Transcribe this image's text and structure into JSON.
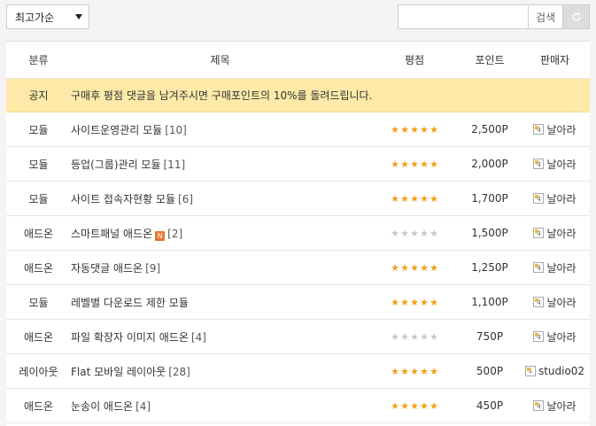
{
  "toolbar": {
    "sort_selected": "최고가순",
    "search_placeholder": "",
    "search_value": "",
    "search_button": "검색",
    "reset_icon": "refresh-icon"
  },
  "columns": {
    "category": "분류",
    "title": "제목",
    "rating": "평점",
    "point": "포인트",
    "seller": "판매자"
  },
  "notice": {
    "category": "공지",
    "text": "구매후 평점 댓글을 남겨주시면 구매포인트의 10%를 돌려드립니다."
  },
  "colors": {
    "star_on": "#f1a01a",
    "star_off": "#c8c8c8",
    "notice_bg": "#fdeaa8"
  },
  "items": [
    {
      "category": "모듈",
      "title": "사이트운영관리 모듈",
      "count": "[10]",
      "new": "",
      "stars": 5,
      "point": "2,500P",
      "seller": "날아라",
      "seller_icon": "q"
    },
    {
      "category": "모듈",
      "title": "등업(그룹)관리 모듈",
      "count": "[11]",
      "new": "",
      "stars": 5,
      "point": "2,000P",
      "seller": "날아라",
      "seller_icon": "q"
    },
    {
      "category": "모듈",
      "title": "사이트 접속자현황 모듈",
      "count": "[6]",
      "new": "",
      "stars": 5,
      "point": "1,700P",
      "seller": "날아라",
      "seller_icon": "q"
    },
    {
      "category": "애드온",
      "title": "스마트패널 애드온",
      "count": "[2]",
      "new": "N",
      "stars": 0,
      "point": "1,500P",
      "seller": "날아라",
      "seller_icon": "q"
    },
    {
      "category": "애드온",
      "title": "자동댓글 애드온",
      "count": "[9]",
      "new": "",
      "stars": 5,
      "point": "1,250P",
      "seller": "날아라",
      "seller_icon": "q"
    },
    {
      "category": "모듈",
      "title": "레벨별 다운로드 제한 모듈",
      "count": "",
      "new": "",
      "stars": 5,
      "point": "1,100P",
      "seller": "날아라",
      "seller_icon": "q"
    },
    {
      "category": "애드온",
      "title": "파일 확장자 이미지 애드온",
      "count": "[4]",
      "new": "",
      "stars": 0,
      "point": "750P",
      "seller": "날아라",
      "seller_icon": "q"
    },
    {
      "category": "레이아웃",
      "title": "Flat 모바일 레이아웃",
      "count": "[28]",
      "new": "",
      "stars": 5,
      "point": "500P",
      "seller": "studio02",
      "seller_icon": "1"
    },
    {
      "category": "애드온",
      "title": "눈송이 애드온",
      "count": "[4]",
      "new": "",
      "stars": 5,
      "point": "450P",
      "seller": "날아라",
      "seller_icon": "q"
    }
  ]
}
